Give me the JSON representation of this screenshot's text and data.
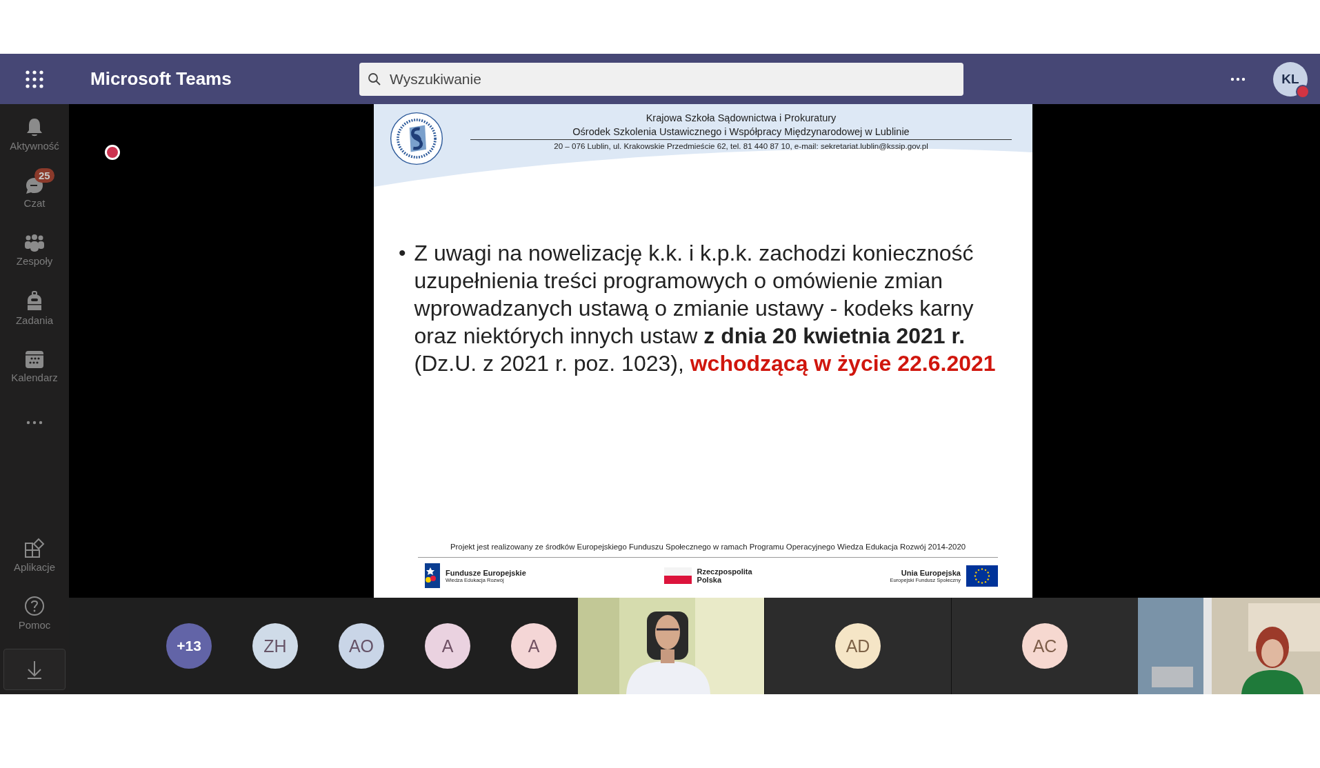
{
  "header": {
    "title": "Microsoft Teams",
    "search": {
      "placeholder": "Wyszukiwanie"
    },
    "account": {
      "initials": "KL"
    }
  },
  "sidebar": {
    "items": [
      {
        "kind": "bell",
        "label": "Aktywność"
      },
      {
        "kind": "chat",
        "label": "Czat",
        "badge": "25"
      },
      {
        "kind": "teams",
        "label": "Zespoły"
      },
      {
        "kind": "backpack",
        "label": "Zadania"
      },
      {
        "kind": "calendar",
        "label": "Kalendarz"
      },
      {
        "kind": "more"
      }
    ],
    "bottom": [
      {
        "kind": "apps",
        "label": "Aplikacje"
      },
      {
        "kind": "help",
        "label": "Pomoc"
      },
      {
        "kind": "download"
      }
    ]
  },
  "slide": {
    "header_lines": [
      "Krajowa Szkoła Sądownictwa i Prokuratury",
      "Ośrodek Szkolenia Ustawicznego i Współpracy Międzynarodowej w Lublinie"
    ],
    "address": "20 – 076 Lublin, ul. Krakowskie Przedmieście 62, tel. 81 440 87 10, e-mail: sekretariat.lublin@kssip.gov.pl",
    "bullet": "•",
    "body": [
      {
        "text": "Z uwagi na nowelizację k.k. i k.p.k. zachodzi konieczność uzupełnienia treści programowych o omówienie zmian wprowadzanych ustawą o zmianie ustawy - kodeks karny oraz niektórych innych ustaw ",
        "kind": "normal"
      },
      {
        "text": "z dnia 20 kwietnia 2021 r.",
        "kind": "bold"
      },
      {
        "text": " (Dz.U. z 2021 r. poz. 1023), ",
        "kind": "normal"
      },
      {
        "text": "wchodzącą w życie 22.6.2021",
        "kind": "highlight"
      }
    ],
    "footer_note": "Projekt jest realizowany ze środków Europejskiego Funduszu Społecznego w ramach Programu Operacyjnego Wiedza Edukacja Rozwój 2014-2020",
    "logos": [
      {
        "kind": "fe",
        "title": "Fundusze Europejskie",
        "subtitle": "Wiedza Edukacja Rozwój"
      },
      {
        "kind": "pl",
        "title": "Rzeczpospolita Polska"
      },
      {
        "kind": "eu",
        "title": "Unia Europejska",
        "subtitle": "Europejski Fundusz Społeczny"
      }
    ]
  },
  "participants": [
    {
      "kind": "overflow",
      "initials": "+13",
      "color": "#6264a7"
    },
    {
      "kind": "avatar",
      "initials": "ZH",
      "color": "#cfdbe8"
    },
    {
      "kind": "avatar",
      "initials": "AO",
      "color": "#c9d5e7"
    },
    {
      "kind": "avatar",
      "initials": "A",
      "color": "#ead2e0"
    },
    {
      "kind": "avatar",
      "initials": "A",
      "color": "#f4d6d6"
    },
    {
      "kind": "video"
    },
    {
      "kind": "tile",
      "initials": "AD",
      "color": "#f5e5c6"
    },
    {
      "kind": "tile",
      "initials": "AC",
      "color": "#f6d8d0"
    },
    {
      "kind": "video"
    }
  ]
}
